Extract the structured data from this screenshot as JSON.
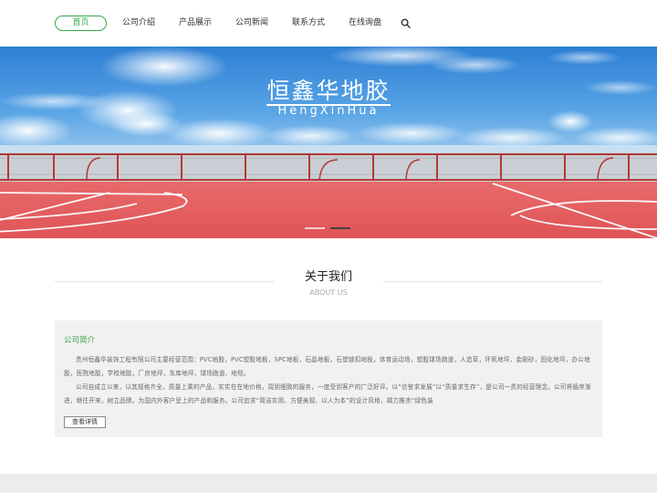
{
  "nav": {
    "items": [
      {
        "label": "首页",
        "active": true
      },
      {
        "label": "公司介绍"
      },
      {
        "label": "产品展示"
      },
      {
        "label": "公司新闻"
      },
      {
        "label": "联系方式"
      },
      {
        "label": "在线询盘"
      }
    ],
    "search_icon": "search-icon"
  },
  "banner": {
    "title": "恒鑫华地胶",
    "subtitle": "HengXinHua",
    "slides": 2,
    "active_slide": 1
  },
  "about": {
    "title": "关于我们",
    "subtitle": "ABOUT US"
  },
  "intro": {
    "title": "公司简介",
    "paragraph1": "贵州恒鑫华装饰工程有限公司主要经营范围：PVC地胶，PVC塑胶地板，SPC地板，石晶地板，石塑锁扣地板，体育运动场，塑胶球场跑道，人造草，环氧地坪，金刚砂，固化地坪，办公地胶，医院地胶，学校地胶，厂房地坪，车库地坪，球场跑道、地毯。",
    "paragraph2": "公司自成立以来，以其规格齐全，质量上乘的产品，实实在在地价格，周到细致的服务，一度受到客户的广泛好评。以“信誉求发展”以“质量求生存”，是公司一贯的经营理念。公司将循序渐进，继往开来，树立品牌。为国内外客户呈上的产品和服务。公司追求“简洁实用、方便美观、以人为本”的设计风格，竭力推崇“绿色装",
    "more_label": "查看详情"
  },
  "colors": {
    "accent": "#3aa54a",
    "court": "#e0585c"
  }
}
